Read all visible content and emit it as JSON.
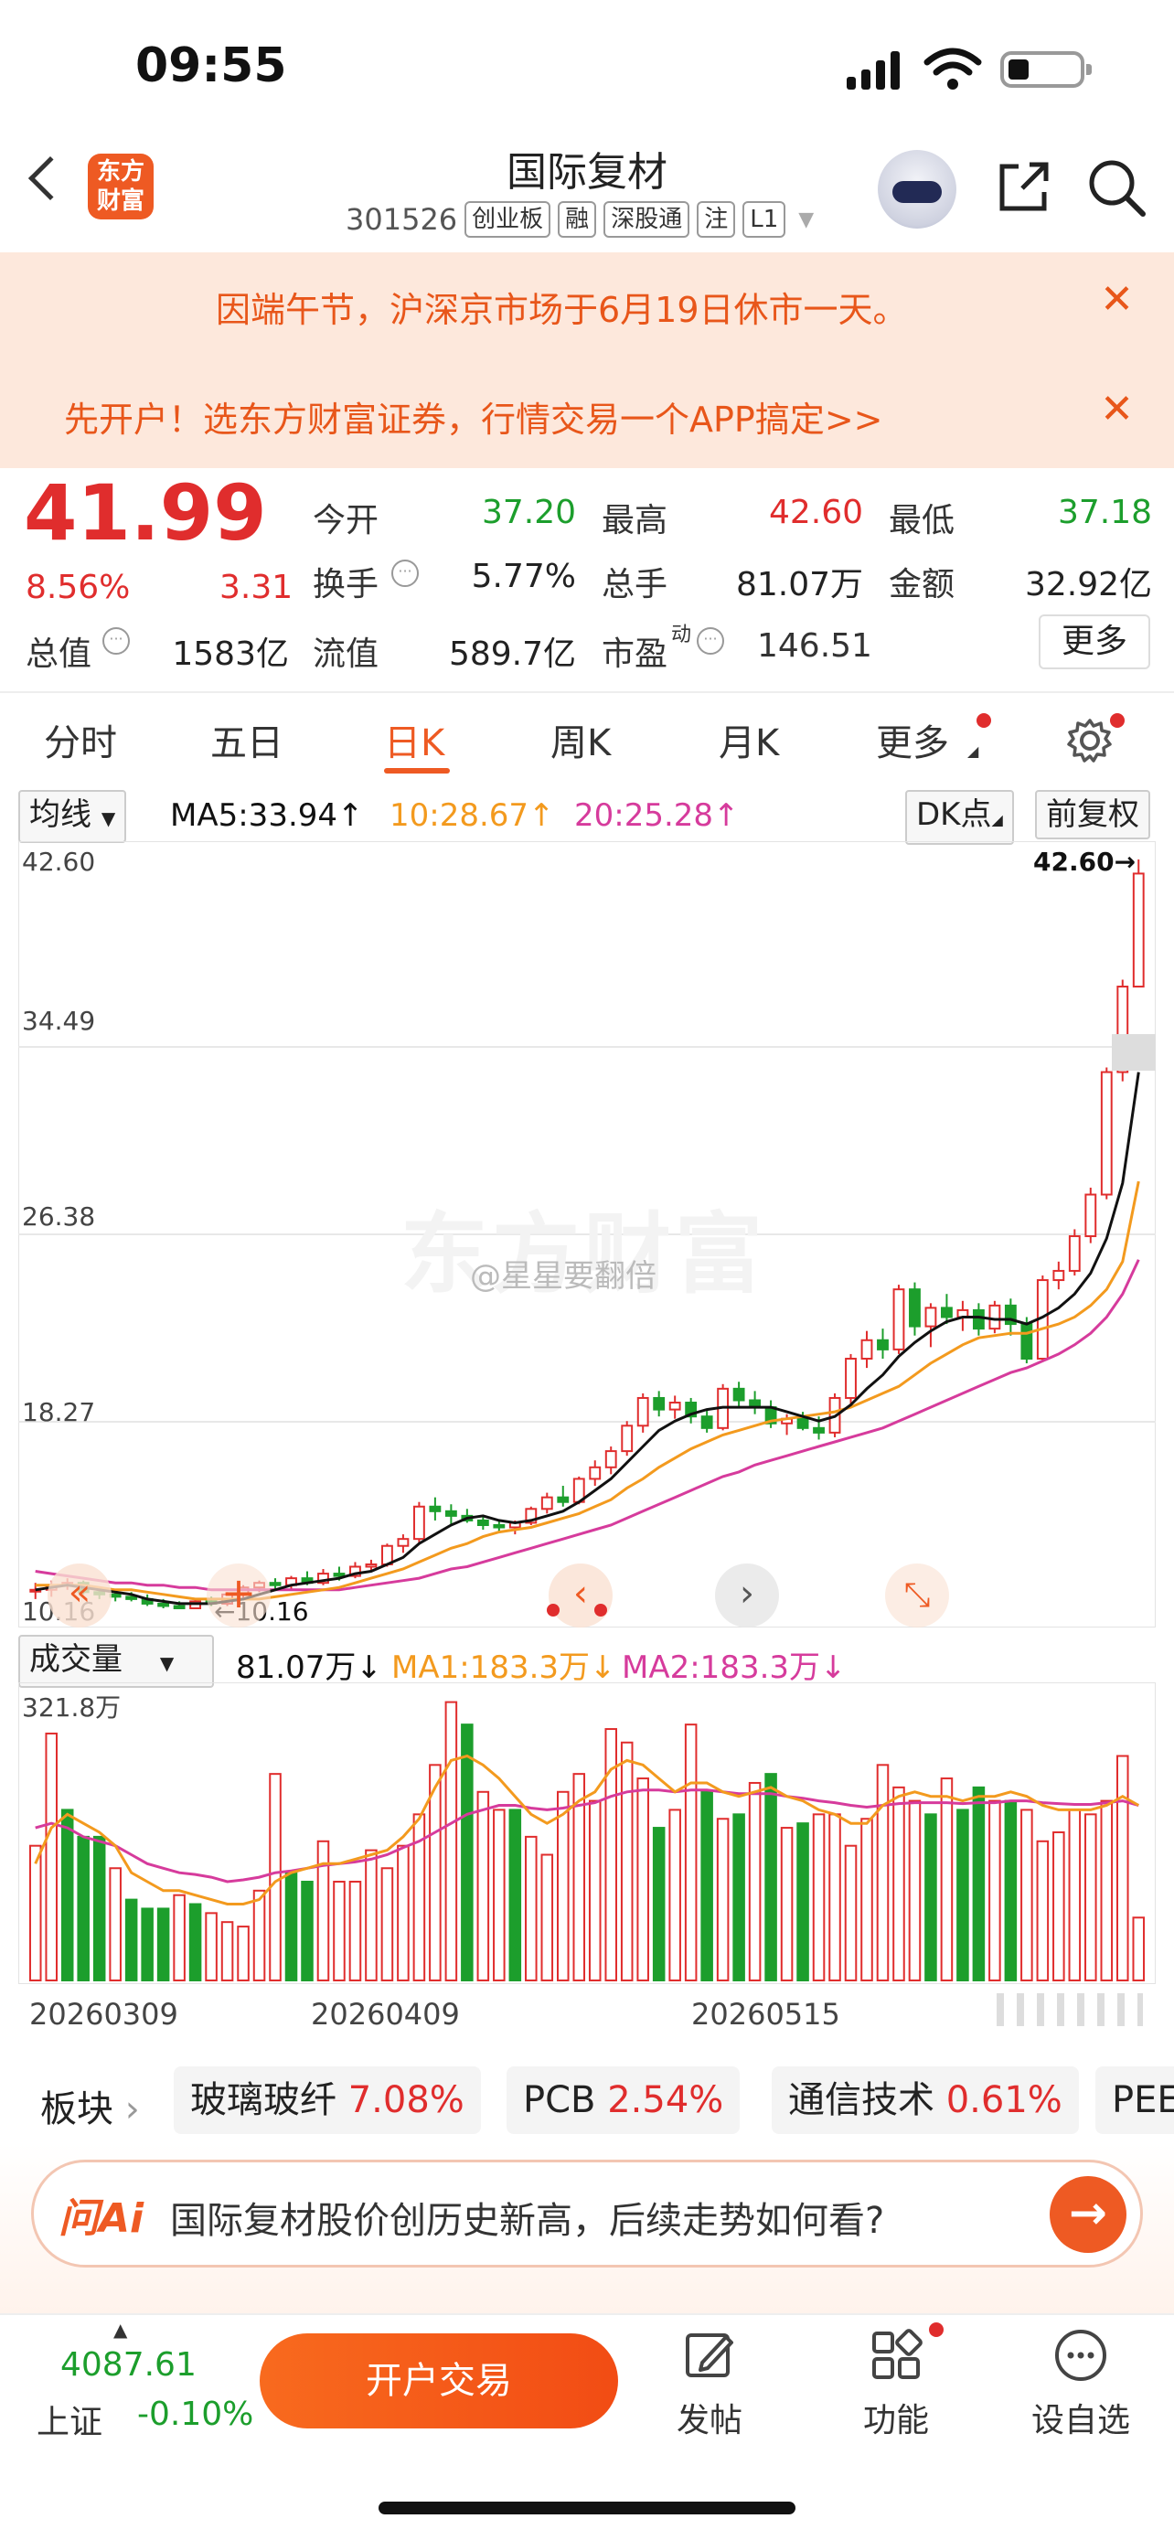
{
  "status_bar": {
    "time": "09:55"
  },
  "header": {
    "logo_text": "东方财富",
    "stock_name": "国际复材",
    "stock_code": "301526",
    "tags": [
      "创业板",
      "融",
      "深股通",
      "注",
      "L1"
    ]
  },
  "banners": [
    {
      "text": "因端午节，沪深京市场于6月19日休市一天。"
    },
    {
      "text": "先开户！选东方财富证券，行情交易一个APP搞定>>"
    }
  ],
  "quote": {
    "price": "41.99",
    "change_pct": "8.56%",
    "change": "3.31",
    "rows": [
      [
        {
          "label": "今开",
          "value": "37.20",
          "color": "green"
        },
        {
          "label": "最高",
          "value": "42.60",
          "color": "red"
        },
        {
          "label": "最低",
          "value": "37.18",
          "color": "green"
        }
      ],
      [
        {
          "label": "换手",
          "value": "5.77%",
          "color": "dark"
        },
        {
          "label": "总手",
          "value": "81.07万",
          "color": "dark"
        },
        {
          "label": "金额",
          "value": "32.92亿",
          "color": "dark"
        }
      ],
      [
        {
          "label": "总值",
          "value": "1583亿",
          "color": "dark"
        },
        {
          "label": "流值",
          "value": "589.7亿",
          "color": "dark"
        },
        {
          "label": "市盈",
          "value": "146.51",
          "color": "dark"
        }
      ]
    ],
    "pe_superscript": "动",
    "more_label": "更多"
  },
  "period_tabs": [
    "分时",
    "五日",
    "日K",
    "周K",
    "月K",
    "更多"
  ],
  "ma_row": {
    "selector_label": "均线",
    "ma5": "MA5:33.94↑",
    "ma10": "10:28.67↑",
    "ma20": "20:25.28↑",
    "dk_label": "DK点",
    "adjust_label": "前复权"
  },
  "kline": {
    "y_ticks": [
      "42.60",
      "34.49",
      "26.38",
      "18.27",
      "10.16"
    ],
    "high_marker": "42.60→",
    "low_marker": "←10.16",
    "watermark": "东方财富",
    "weibo_watermark": "@星星要翻倍"
  },
  "volume_row": {
    "selector_label": "成交量",
    "volume": "81.07万↓",
    "ma1": "MA1:183.3万↓",
    "ma2": "MA2:183.3万↓",
    "max_label": "321.8万",
    "x_labels": [
      "20260309",
      "20260409",
      "20260515"
    ]
  },
  "colors": {
    "up": "#e02d2d",
    "down": "#1c9e2c",
    "ma5": "#111111",
    "ma10": "#f39a1e",
    "ma20": "#d63b9c",
    "accent": "#ee5a23"
  },
  "chart_data": {
    "type": "candlestick",
    "title": "",
    "ylim": [
      10.16,
      42.6
    ],
    "candles": [
      [
        11.0,
        11.3,
        10.6,
        11.0
      ],
      [
        11.0,
        11.4,
        10.7,
        11.2
      ],
      [
        11.2,
        11.5,
        11.0,
        11.3
      ],
      [
        11.3,
        11.4,
        10.8,
        10.9
      ],
      [
        10.9,
        11.0,
        10.6,
        10.8
      ],
      [
        10.8,
        11.0,
        10.5,
        10.7
      ],
      [
        10.7,
        10.9,
        10.5,
        10.6
      ],
      [
        10.6,
        10.8,
        10.3,
        10.4
      ],
      [
        10.4,
        10.6,
        10.2,
        10.3
      ],
      [
        10.3,
        10.5,
        10.16,
        10.2
      ],
      [
        10.2,
        10.6,
        10.2,
        10.5
      ],
      [
        10.5,
        10.7,
        10.3,
        10.4
      ],
      [
        10.4,
        10.9,
        10.3,
        10.8
      ],
      [
        10.8,
        11.2,
        10.6,
        11.1
      ],
      [
        11.1,
        11.4,
        10.9,
        11.3
      ],
      [
        11.3,
        11.5,
        11.0,
        11.2
      ],
      [
        11.2,
        11.6,
        11.0,
        11.5
      ],
      [
        11.5,
        11.8,
        11.2,
        11.3
      ],
      [
        11.3,
        11.9,
        11.2,
        11.7
      ],
      [
        11.7,
        12.0,
        11.4,
        11.6
      ],
      [
        11.6,
        12.2,
        11.5,
        12.0
      ],
      [
        12.0,
        12.3,
        11.8,
        12.1
      ],
      [
        12.1,
        13.0,
        12.0,
        12.9
      ],
      [
        12.9,
        13.4,
        12.6,
        13.2
      ],
      [
        13.2,
        14.8,
        13.0,
        14.6
      ],
      [
        14.6,
        15.0,
        14.0,
        14.4
      ],
      [
        14.4,
        14.7,
        13.8,
        14.2
      ],
      [
        14.2,
        14.5,
        13.9,
        14.0
      ],
      [
        14.0,
        14.2,
        13.6,
        13.8
      ],
      [
        13.8,
        14.0,
        13.5,
        13.7
      ],
      [
        13.7,
        14.0,
        13.4,
        13.9
      ],
      [
        13.9,
        14.6,
        13.8,
        14.5
      ],
      [
        14.5,
        15.2,
        14.3,
        15.0
      ],
      [
        15.0,
        15.5,
        14.6,
        14.8
      ],
      [
        14.8,
        15.9,
        14.7,
        15.8
      ],
      [
        15.8,
        16.6,
        15.5,
        16.3
      ],
      [
        16.3,
        17.2,
        16.0,
        17.0
      ],
      [
        17.0,
        18.3,
        16.8,
        18.1
      ],
      [
        18.1,
        19.5,
        17.8,
        19.3
      ],
      [
        19.3,
        19.6,
        18.5,
        18.8
      ],
      [
        18.8,
        19.4,
        18.4,
        19.1
      ],
      [
        19.1,
        19.3,
        18.2,
        18.5
      ],
      [
        18.5,
        18.8,
        17.8,
        18.0
      ],
      [
        18.0,
        19.9,
        17.9,
        19.7
      ],
      [
        19.7,
        20.0,
        18.9,
        19.2
      ],
      [
        19.2,
        19.6,
        18.6,
        18.9
      ],
      [
        18.9,
        19.2,
        18.0,
        18.2
      ],
      [
        18.2,
        18.6,
        17.7,
        18.4
      ],
      [
        18.4,
        18.7,
        17.9,
        18.0
      ],
      [
        18.0,
        18.5,
        17.5,
        17.8
      ],
      [
        17.8,
        19.5,
        17.6,
        19.3
      ],
      [
        19.3,
        21.2,
        19.0,
        21.0
      ],
      [
        21.0,
        22.2,
        20.6,
        21.8
      ],
      [
        21.8,
        22.3,
        21.0,
        21.4
      ],
      [
        21.4,
        24.2,
        21.2,
        24.0
      ],
      [
        24.0,
        24.3,
        22.0,
        22.4
      ],
      [
        22.4,
        23.4,
        21.5,
        23.2
      ],
      [
        23.2,
        23.8,
        22.5,
        22.8
      ],
      [
        22.8,
        23.5,
        22.2,
        23.1
      ],
      [
        23.1,
        23.4,
        22.0,
        22.3
      ],
      [
        22.3,
        23.5,
        22.1,
        23.3
      ],
      [
        23.3,
        23.6,
        22.0,
        22.5
      ],
      [
        22.5,
        22.8,
        20.8,
        21.0
      ],
      [
        21.0,
        24.6,
        20.9,
        24.4
      ],
      [
        24.4,
        25.2,
        24.0,
        24.8
      ],
      [
        24.8,
        26.6,
        24.6,
        26.3
      ],
      [
        26.3,
        28.4,
        26.0,
        28.1
      ],
      [
        28.1,
        33.6,
        27.9,
        33.4
      ],
      [
        33.4,
        37.4,
        33.0,
        37.1
      ],
      [
        37.1,
        42.6,
        37.18,
        41.99
      ]
    ],
    "ma5": [
      11.0,
      11.1,
      11.2,
      11.1,
      11.0,
      10.9,
      10.8,
      10.6,
      10.5,
      10.4,
      10.4,
      10.4,
      10.5,
      10.6,
      10.8,
      11.0,
      11.2,
      11.3,
      11.4,
      11.5,
      11.7,
      11.8,
      12.1,
      12.4,
      13.0,
      13.4,
      13.8,
      14.1,
      14.2,
      14.0,
      13.9,
      14.0,
      14.2,
      14.4,
      14.8,
      15.3,
      15.8,
      16.5,
      17.2,
      17.9,
      18.3,
      18.6,
      18.8,
      18.9,
      18.9,
      18.9,
      18.9,
      18.7,
      18.5,
      18.3,
      18.5,
      19.0,
      19.7,
      20.3,
      21.1,
      21.7,
      22.2,
      22.6,
      22.8,
      22.8,
      22.7,
      22.7,
      22.5,
      22.8,
      23.2,
      23.8,
      24.7,
      26.2,
      28.6,
      33.4
    ],
    "ma10": [
      11.2,
      11.2,
      11.2,
      11.2,
      11.1,
      11.0,
      11.0,
      10.9,
      10.8,
      10.7,
      10.6,
      10.6,
      10.6,
      10.6,
      10.6,
      10.7,
      10.8,
      10.9,
      11.0,
      11.1,
      11.3,
      11.5,
      11.7,
      11.9,
      12.2,
      12.5,
      12.8,
      13.0,
      13.3,
      13.5,
      13.6,
      13.7,
      13.9,
      14.1,
      14.3,
      14.6,
      14.9,
      15.4,
      15.8,
      16.3,
      16.7,
      17.1,
      17.4,
      17.7,
      17.9,
      18.1,
      18.3,
      18.4,
      18.5,
      18.6,
      18.7,
      18.9,
      19.2,
      19.5,
      19.8,
      20.3,
      20.8,
      21.2,
      21.6,
      21.9,
      22.0,
      22.1,
      22.1,
      22.3,
      22.5,
      22.8,
      23.3,
      24.0,
      25.2,
      28.67
    ],
    "ma20": [
      11.8,
      11.7,
      11.6,
      11.5,
      11.4,
      11.3,
      11.3,
      11.2,
      11.2,
      11.1,
      11.1,
      11.0,
      11.0,
      11.0,
      11.0,
      11.0,
      11.0,
      11.0,
      11.0,
      11.0,
      11.1,
      11.2,
      11.3,
      11.4,
      11.5,
      11.7,
      11.9,
      12.0,
      12.2,
      12.4,
      12.6,
      12.8,
      13.0,
      13.2,
      13.4,
      13.6,
      13.8,
      14.1,
      14.4,
      14.7,
      15.0,
      15.3,
      15.6,
      15.9,
      16.1,
      16.4,
      16.6,
      16.8,
      17.0,
      17.2,
      17.4,
      17.6,
      17.8,
      18.0,
      18.3,
      18.6,
      18.9,
      19.2,
      19.5,
      19.8,
      20.1,
      20.4,
      20.6,
      20.9,
      21.2,
      21.6,
      22.1,
      22.8,
      23.8,
      25.28
    ]
  },
  "volume_data": {
    "max": 321.8,
    "values": [
      150,
      275,
      190,
      160,
      160,
      125,
      90,
      80,
      80,
      95,
      85,
      75,
      65,
      60,
      100,
      230,
      120,
      110,
      155,
      110,
      110,
      145,
      125,
      150,
      185,
      240,
      310,
      285,
      210,
      190,
      190,
      160,
      140,
      210,
      230,
      200,
      280,
      265,
      225,
      170,
      190,
      285,
      210,
      180,
      185,
      220,
      230,
      170,
      175,
      185,
      185,
      150,
      180,
      240,
      215,
      200,
      185,
      225,
      190,
      215,
      200,
      200,
      190,
      155,
      165,
      190,
      185,
      200,
      250,
      70
    ],
    "up": [
      1,
      1,
      0,
      0,
      0,
      1,
      0,
      0,
      0,
      1,
      0,
      1,
      1,
      1,
      1,
      1,
      0,
      0,
      1,
      1,
      1,
      1,
      1,
      1,
      1,
      1,
      1,
      0,
      1,
      1,
      0,
      1,
      1,
      1,
      1,
      1,
      1,
      1,
      1,
      0,
      1,
      1,
      0,
      1,
      0,
      1,
      0,
      1,
      0,
      1,
      1,
      1,
      1,
      1,
      1,
      1,
      0,
      1,
      0,
      0,
      1,
      0,
      1,
      1,
      1,
      1,
      1,
      1,
      1,
      1
    ],
    "ma1": [
      130,
      170,
      185,
      175,
      165,
      150,
      120,
      110,
      100,
      100,
      95,
      90,
      85,
      85,
      90,
      110,
      120,
      125,
      130,
      130,
      135,
      140,
      145,
      160,
      180,
      215,
      245,
      250,
      240,
      225,
      205,
      185,
      175,
      185,
      200,
      210,
      235,
      245,
      240,
      225,
      210,
      220,
      220,
      210,
      205,
      210,
      215,
      205,
      200,
      190,
      185,
      175,
      175,
      195,
      205,
      210,
      205,
      205,
      200,
      205,
      205,
      210,
      205,
      195,
      190,
      190,
      190,
      195,
      205,
      195
    ],
    "ma2": [
      170,
      175,
      170,
      160,
      155,
      150,
      140,
      130,
      125,
      120,
      118,
      115,
      110,
      112,
      115,
      120,
      122,
      125,
      128,
      130,
      132,
      135,
      140,
      148,
      155,
      165,
      175,
      185,
      190,
      195,
      195,
      192,
      190,
      192,
      195,
      198,
      205,
      210,
      212,
      212,
      210,
      212,
      212,
      210,
      208,
      208,
      208,
      205,
      203,
      200,
      198,
      195,
      193,
      195,
      197,
      198,
      198,
      198,
      197,
      198,
      198,
      200,
      200,
      198,
      197,
      196,
      196,
      198,
      200,
      195
    ]
  },
  "sectors": {
    "label": "板块",
    "items": [
      {
        "name": "玻璃玻纤",
        "pct": "7.08%"
      },
      {
        "name": "PCB",
        "pct": "2.54%"
      },
      {
        "name": "通信技术",
        "pct": "0.61%"
      },
      {
        "name": "PEE",
        "pct": ""
      }
    ]
  },
  "ai": {
    "logo": "问Ai",
    "question": "国际复材股价创历史新高，后续走势如何看?"
  },
  "bottom_bar": {
    "index_value": "4087.61",
    "index_name": "上证",
    "index_change": "-0.10%",
    "trade_button": "开户交易",
    "nav": [
      {
        "label": "发帖",
        "icon": "edit-icon"
      },
      {
        "label": "功能",
        "icon": "grid-icon"
      },
      {
        "label": "设自选",
        "icon": "more-icon"
      }
    ]
  }
}
